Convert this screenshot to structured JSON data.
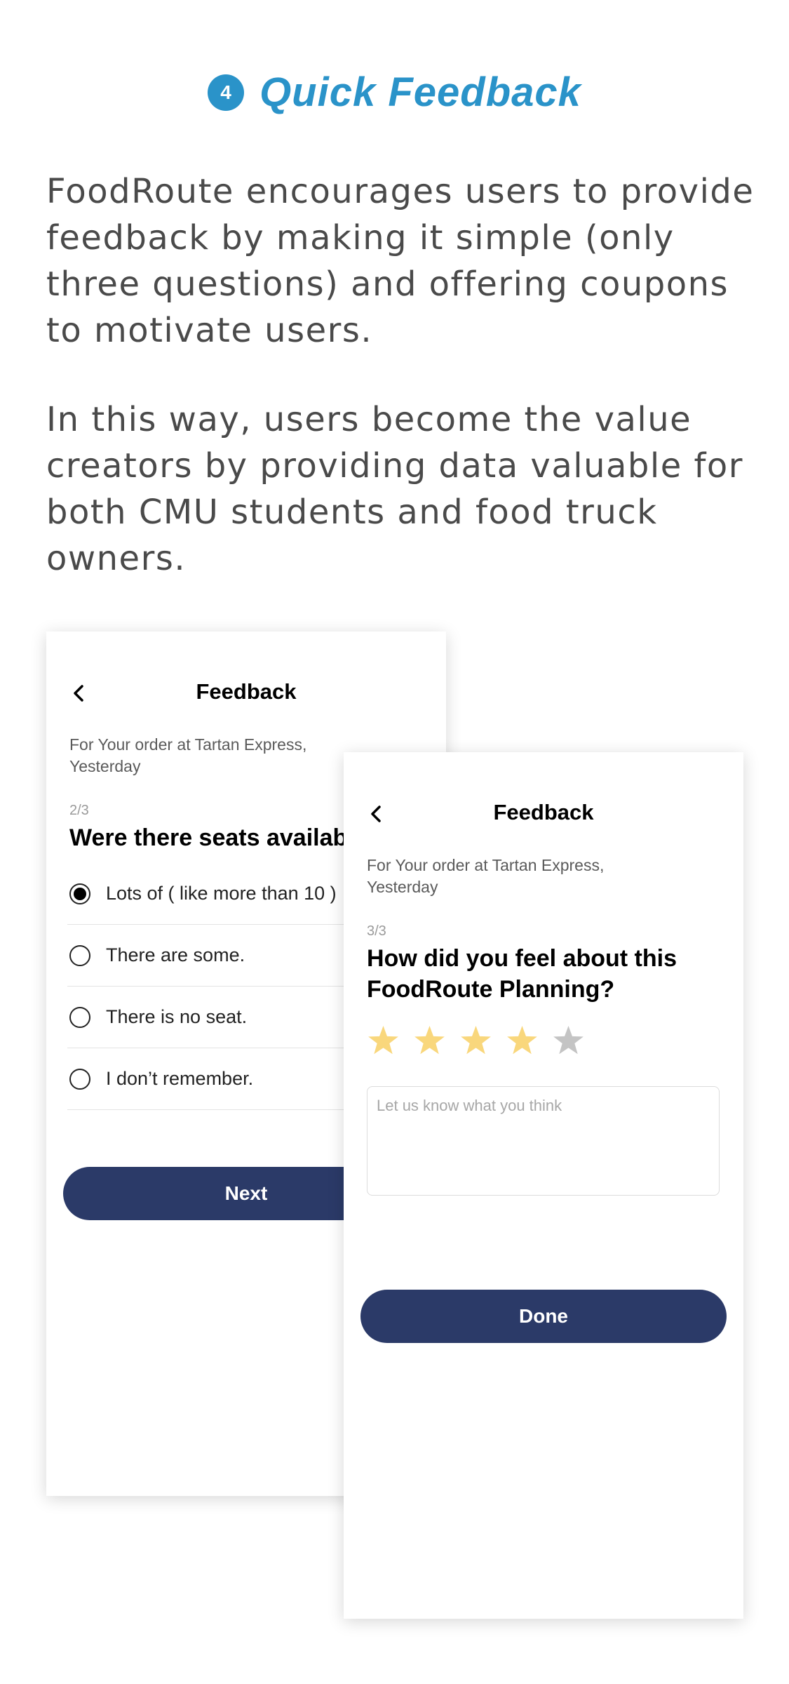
{
  "header": {
    "step_number": "4",
    "title": "Quick Feedback"
  },
  "paragraphs": [
    "FoodRoute encourages users to provide feedback by making it simple (only three questions) and offering coupons to motivate users.",
    "In this way, users become the value creators by providing data valuable for both CMU students and food truck owners."
  ],
  "screen1": {
    "nav_title": "Feedback",
    "order_info": "For Your order at Tartan Express, Yesterday",
    "step": "2/3",
    "question": "Were there seats available?",
    "options": [
      {
        "label": "Lots of ( like more than 10 )",
        "checked": true
      },
      {
        "label": "There are some.",
        "checked": false
      },
      {
        "label": "There is no seat.",
        "checked": false
      },
      {
        "label": "I don’t remember.",
        "checked": false
      }
    ],
    "button": "Next"
  },
  "screen2": {
    "nav_title": "Feedback",
    "order_info": "For Your order at Tartan Express, Yesterday",
    "step": "3/3",
    "question": "How did you feel about this FoodRoute Planning?",
    "rating": 4,
    "rating_max": 5,
    "placeholder": "Let us know what you think",
    "button": "Done"
  },
  "colors": {
    "accent": "#2a93c9",
    "button": "#2b3a68",
    "star_filled": "#f9d77c",
    "star_empty": "#c4c4c4"
  }
}
